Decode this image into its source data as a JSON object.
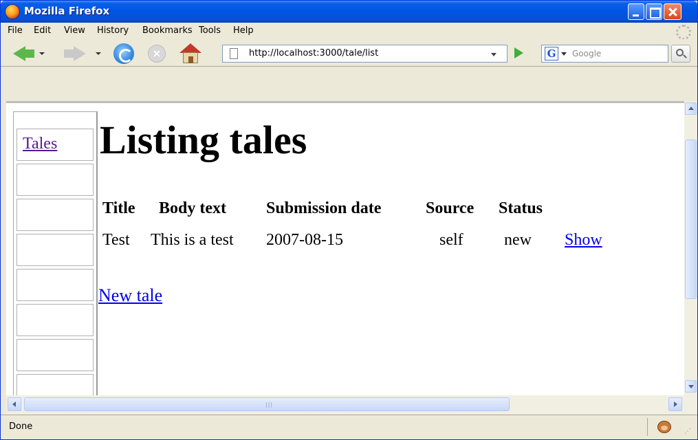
{
  "window": {
    "title": "Mozilla Firefox"
  },
  "menubar": {
    "items": [
      "File",
      "Edit",
      "View",
      "History",
      "Bookmarks",
      "Tools",
      "Help"
    ]
  },
  "toolbar": {
    "url": "http://localhost:3000/tale/list",
    "search_placeholder": "Google",
    "search_engine_letter": "G",
    "icons": [
      "back-arrow-icon",
      "forward-arrow-icon",
      "reload-icon",
      "stop-icon",
      "home-icon",
      "page-icon",
      "go-icon",
      "search-icon"
    ]
  },
  "sidebar": {
    "link": "Tales"
  },
  "page": {
    "title": "Listing tales",
    "table": {
      "headers": [
        "Title",
        "Body text",
        "Submission date",
        "Source",
        "Status"
      ],
      "rows": [
        {
          "title": "Test",
          "body": "This is a test",
          "date": "2007-08-15",
          "source": "self",
          "status": "new",
          "action": "Show"
        }
      ]
    },
    "new_link": "New tale"
  },
  "statusbar": {
    "text": "Done"
  },
  "colors": {
    "titlebar": "#0054e3",
    "link": "#0000ee",
    "visited_link": "#551a8b",
    "chrome": "#ece9d8"
  }
}
